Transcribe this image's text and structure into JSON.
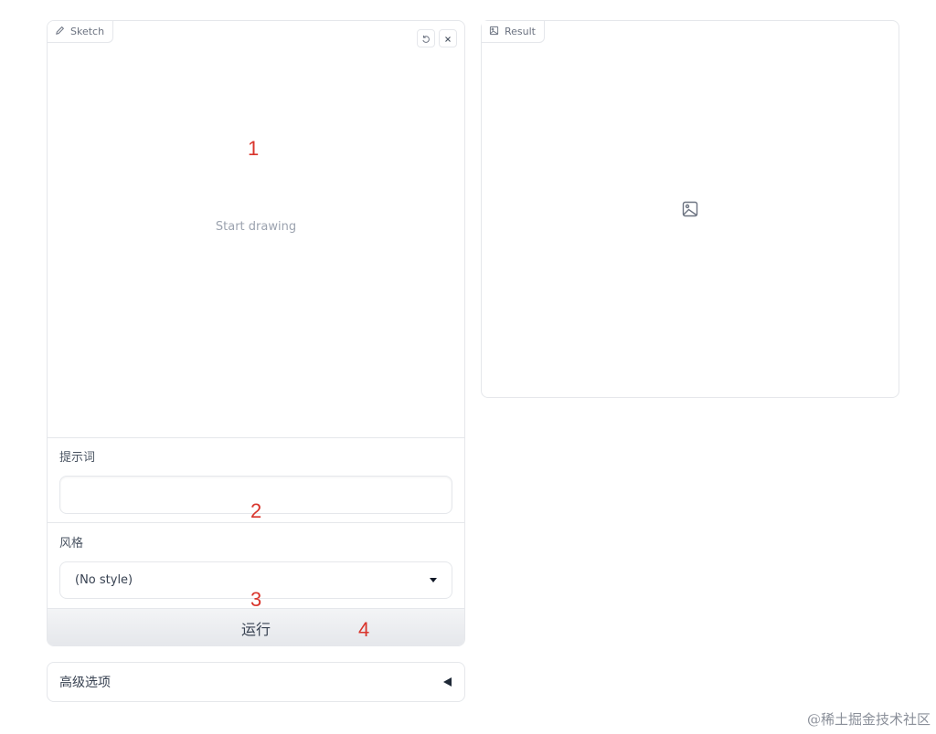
{
  "sketch": {
    "label": "Sketch",
    "placeholder": "Start drawing",
    "undo_icon": "undo-icon",
    "clear_icon": "close-icon"
  },
  "prompt": {
    "label": "提示词",
    "value": ""
  },
  "style": {
    "label": "风格",
    "selected": "(No style)"
  },
  "run_button": {
    "label": "运行"
  },
  "advanced": {
    "label": "高级选项"
  },
  "result": {
    "label": "Result",
    "empty_icon": "image-icon"
  },
  "annotations": [
    "1",
    "2",
    "3",
    "4"
  ],
  "watermark": "@稀土掘金技术社区",
  "colors": {
    "annotation": "#d9342b",
    "border": "#e5e7eb",
    "muted_text": "#9ca3af"
  }
}
